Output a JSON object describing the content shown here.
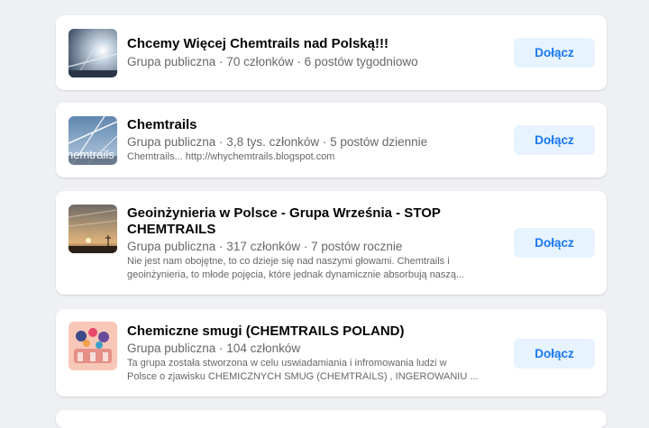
{
  "groups": [
    {
      "title": "Chcemy Więcej Chemtrails nad Polską!!!",
      "meta": "Grupa publiczna · 70 członków · 6 postów tygodniowo",
      "description": [],
      "thumb_icon": "sky-chemtrail-photo",
      "join_label": "Dołącz"
    },
    {
      "title": "Chemtrails",
      "meta": "Grupa publiczna · 3,8 tys. członków · 5 postów dziennie",
      "description": [
        "Chemtrails... http://whychemtrails.blogspot.com"
      ],
      "thumb_icon": "chemtrails-logo-photo",
      "thumb_text": "hemtrails",
      "join_label": "Dołącz"
    },
    {
      "title": "Geoinżynieria w Polsce - Grupa Września - STOP CHEMTRAILS",
      "meta": "Grupa publiczna · 317 członków · 7 postów rocznie",
      "description": [
        "Nie jest nam obojętne, to co dzieje się nad naszymi głowami. Chemtrails i",
        "geoinżynieria, to młode pojęcia, które jednak dynamicznie absorbują naszą..."
      ],
      "thumb_icon": "sunset-sky-photo",
      "join_label": "Dołącz"
    },
    {
      "title": "Chemiczne smugi (CHEMTRAILS POLAND)",
      "meta": "Grupa publiczna · 104 członków",
      "description": [
        "Ta grupa została stworzona w celu uswiadamiania i infromowania ludzi w",
        "Polsce o zjawisku CHEMICZNYCH SMUG (CHEMTRAILS) , INGEROWANIU ..."
      ],
      "thumb_icon": "group-illustration",
      "join_label": "Dołącz"
    }
  ],
  "colors": {
    "background": "#eef0f3",
    "card": "#ffffff",
    "button_bg": "#e7f3ff",
    "button_text": "#1877f2",
    "secondary_text": "#65676b"
  }
}
